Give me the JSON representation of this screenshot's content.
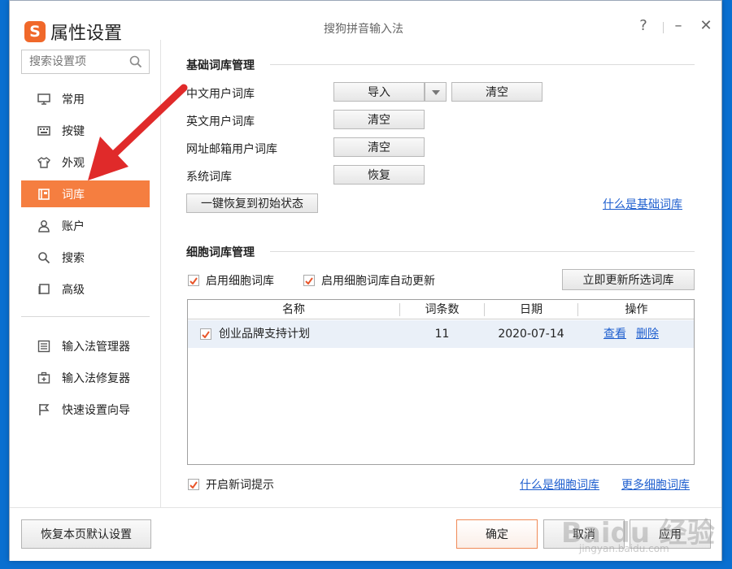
{
  "window": {
    "logo": "S",
    "title": "属性设置",
    "app_name": "搜狗拼音输入法",
    "help": "?",
    "minimize": "–",
    "close": "✕"
  },
  "sidebar": {
    "search_placeholder": "搜索设置项",
    "items": [
      {
        "label": "常用",
        "icon": "monitor-icon"
      },
      {
        "label": "按键",
        "icon": "keyboard-icon"
      },
      {
        "label": "外观",
        "icon": "shirt-icon"
      },
      {
        "label": "词库",
        "icon": "book-icon",
        "active": true
      },
      {
        "label": "账户",
        "icon": "user-icon"
      },
      {
        "label": "搜索",
        "icon": "search-icon"
      },
      {
        "label": "高级",
        "icon": "square-icon"
      }
    ],
    "tools": [
      {
        "label": "输入法管理器",
        "icon": "list-icon"
      },
      {
        "label": "输入法修复器",
        "icon": "toolbox-icon"
      },
      {
        "label": "快速设置向导",
        "icon": "flag-icon"
      }
    ]
  },
  "basic": {
    "title": "基础词库管理",
    "rows": [
      {
        "label": "中文用户词库",
        "buttons": [
          "导入",
          "清空"
        ]
      },
      {
        "label": "英文用户词库",
        "buttons": [
          "清空"
        ]
      },
      {
        "label": "网址邮箱用户词库",
        "buttons": [
          "清空"
        ]
      },
      {
        "label": "系统词库",
        "buttons": [
          "恢复"
        ]
      }
    ],
    "restore_all": "一键恢复到初始状态",
    "help_link": "什么是基础词库"
  },
  "cell": {
    "title": "细胞词库管理",
    "enable": "启用细胞词库",
    "auto_update": "启用细胞词库自动更新",
    "update_now": "立即更新所选词库",
    "columns": [
      "名称",
      "词条数",
      "日期",
      "操作"
    ],
    "rows": [
      {
        "name": "创业品牌支持计划",
        "count": "11",
        "date": "2020-07-14",
        "checked": true,
        "actions": [
          "查看",
          "删除"
        ]
      }
    ],
    "new_word_hint": "开启新词提示",
    "link_what": "什么是细胞词库",
    "link_more": "更多细胞词库"
  },
  "footer": {
    "reset": "恢复本页默认设置",
    "ok": "确定",
    "cancel": "取消",
    "apply": "应用"
  },
  "colors": {
    "accent": "#f57e40",
    "link": "#1f5fcf",
    "desktop": "#0a6fd0",
    "annotation_arrow": "#e02a2a"
  },
  "watermark": {
    "brand": "Baidu 经验",
    "url": "jingyan.baidu.com"
  }
}
